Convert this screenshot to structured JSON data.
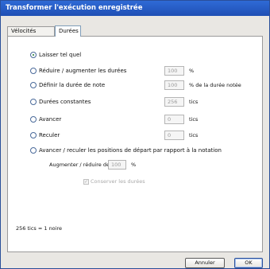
{
  "window": {
    "title": "Transformer l'exécution enregistrée"
  },
  "tabs": [
    {
      "label": "Vélocités",
      "selected": false
    },
    {
      "label": "Durées",
      "selected": true
    }
  ],
  "options": [
    {
      "label": "Laisser tel quel",
      "selected": true
    },
    {
      "label": "Réduire / augmenter les durées",
      "selected": false,
      "value": "100",
      "unit": "%"
    },
    {
      "label": "Définir la durée de note",
      "selected": false,
      "value": "100",
      "unit": "% de la durée notée"
    },
    {
      "label": "Durées constantes",
      "selected": false,
      "value": "256",
      "unit": "tics"
    },
    {
      "label": "Avancer",
      "selected": false,
      "value": "0",
      "unit": "tics"
    },
    {
      "label": "Reculer",
      "selected": false,
      "value": "0",
      "unit": "tics"
    },
    {
      "label": "Avancer / reculer les positions de départ par rapport à la notation",
      "selected": false
    }
  ],
  "adjust": {
    "label": "Augmenter / réduire de",
    "value": "100",
    "unit": "%"
  },
  "keep_durations": {
    "label": "Conserver les durées",
    "checked": true,
    "enabled": false
  },
  "footer_note": "256 tics = 1 noire",
  "buttons": {
    "cancel": "Annuler",
    "ok": "OK"
  },
  "colors": {
    "titlebar": "#1f4fb4",
    "radio_dot": "#1d7a2c"
  }
}
